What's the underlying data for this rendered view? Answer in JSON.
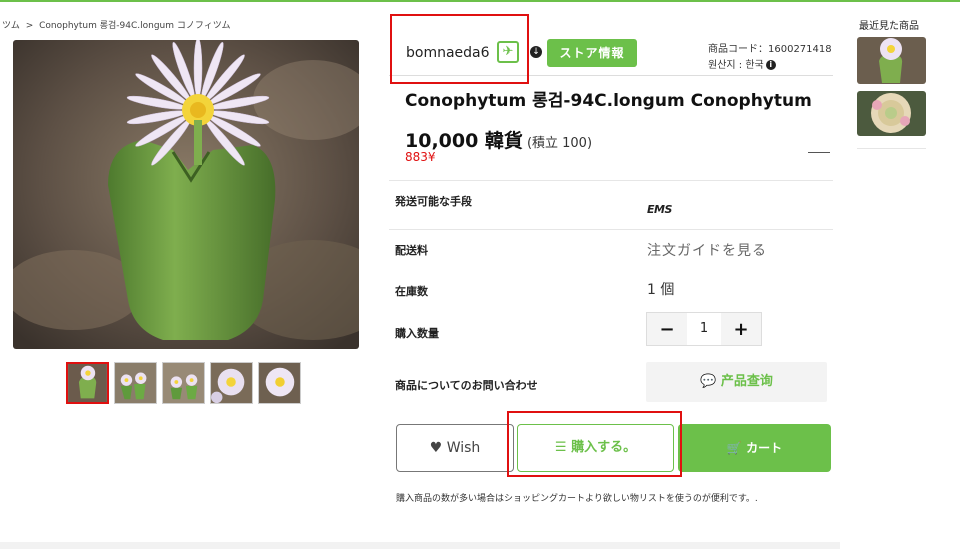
{
  "breadcrumb": [
    "ツム",
    ">",
    "Conophytum 롱검-94C.longum コノフィツム"
  ],
  "seller": {
    "name": "bomnaeda6",
    "store_button": "ストア情報",
    "product_code": "商品コード：1600271418",
    "origin": "원산지 : 한국"
  },
  "product": {
    "title": "Conophytum 롱검-94C.longum Conophytum",
    "price": "10,000 韓貨",
    "points": "(積立 100)",
    "yen": "883¥"
  },
  "info": {
    "shipping_label": "発送可能な手段",
    "shipping_value": "EMS",
    "fee_label": "配送料",
    "fee_value": "注文ガイドを見る",
    "stock_label": "在庫数",
    "stock_value": "1 個",
    "qty_label": "購入数量",
    "qty_minus": "−",
    "qty_value": "1",
    "qty_plus": "+",
    "inquiry_label": "商品についてのお問い合わせ",
    "inquiry_button": "产品查询"
  },
  "actions": {
    "wish": "Wish",
    "buy": "購入する。",
    "cart": "カート"
  },
  "note": "購入商品の数が多い場合はショッピングカートより欲しい物リストを使うのが便利です。.",
  "recent": {
    "title": "最近見た商品"
  },
  "colors": {
    "accent": "#6cc04a",
    "highlight": "#e01010",
    "yen": "#e01010"
  }
}
